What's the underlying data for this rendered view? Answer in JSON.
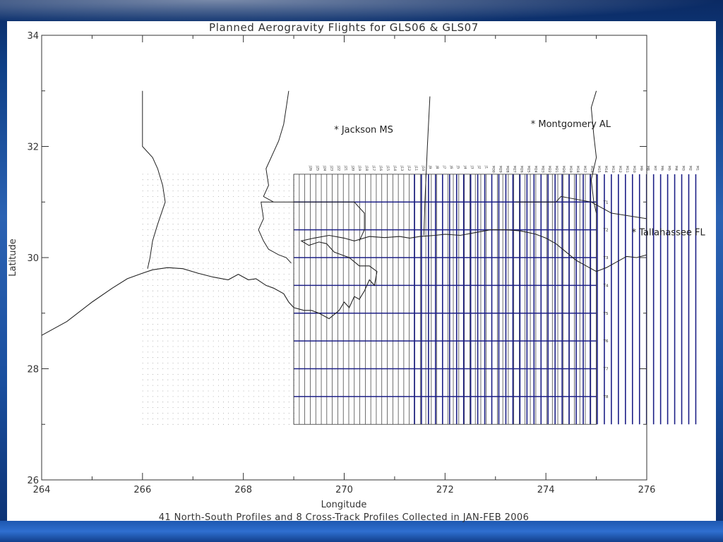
{
  "chart_data": {
    "type": "line",
    "title": "Planned Aerogravity Flights for GLS06 & GLS07",
    "subtitle": "41 North-South Profiles and 8 Cross-Track Profiles Collected in JAN-FEB 2006",
    "xlabel": "Longitude",
    "ylabel": "Latitude",
    "xlim": [
      264,
      276
    ],
    "ylim": [
      26,
      34
    ],
    "x_ticks": [
      "264",
      "266",
      "268",
      "270",
      "272",
      "274",
      "276"
    ],
    "y_ticks": [
      "26",
      "28",
      "30",
      "32",
      "34"
    ],
    "grid": false,
    "cities": [
      {
        "label": "Jackson MS",
        "lon": 269.8,
        "lat": 32.3
      },
      {
        "label": "Montgomery AL",
        "lon": 273.7,
        "lat": 32.4
      },
      {
        "label": "Tallahassee FL",
        "lon": 275.7,
        "lat": 30.45
      }
    ],
    "dotted_grid": {
      "lon_range": [
        266.0,
        269.0
      ],
      "lat_range": [
        27.0,
        31.5
      ],
      "lon_step": 0.1,
      "lat_step": 0.1
    },
    "planned_ns_lines": {
      "lon_start": 269.0,
      "lon_end": 275.0,
      "count": 56,
      "lat_range": [
        27.0,
        31.5
      ]
    },
    "ns_profiles": {
      "lon_start": 269.3,
      "lon_step": 0.1395,
      "lat_range": [
        27.0,
        31.5
      ],
      "labels": [
        "J26",
        "J25",
        "J24",
        "J23",
        "J22",
        "J21",
        "J20",
        "J19",
        "J18",
        "J17",
        "J16",
        "J15",
        "J14",
        "J13",
        "J12",
        "J11",
        "J10",
        "J9",
        "J8",
        "J7",
        "J6",
        "J5",
        "J4",
        "J3",
        "J2",
        "J1",
        "M30",
        "M29",
        "M28",
        "M27",
        "M26",
        "M25",
        "M24",
        "M23",
        "M22",
        "M21",
        "M20",
        "M19",
        "M18",
        "M17",
        "M16",
        "M15",
        "M14",
        "M13",
        "M12",
        "M11",
        "M10",
        "M9",
        "M8",
        "M7",
        "M6",
        "M5",
        "M4",
        "M3",
        "M2",
        "M1"
      ],
      "collected_from_index": 15
    },
    "cross_track_profiles": [
      {
        "label": "T1",
        "lat": 31.0
      },
      {
        "label": "T2",
        "lat": 30.5
      },
      {
        "label": "T3",
        "lat": 30.0
      },
      {
        "label": "T4",
        "lat": 29.5
      },
      {
        "label": "T5",
        "lat": 29.0
      },
      {
        "label": "T6",
        "lat": 28.5
      },
      {
        "label": "T7",
        "lat": 28.0
      },
      {
        "label": "T8",
        "lat": 27.5
      }
    ],
    "cross_track_lon_range": [
      269.0,
      275.0
    ],
    "colors": {
      "collected": "#1c1f86",
      "planned": "#333333",
      "coast": "#222222"
    },
    "coastline": [
      [
        264.0,
        28.6
      ],
      [
        264.5,
        28.85
      ],
      [
        265.0,
        29.2
      ],
      [
        265.4,
        29.45
      ],
      [
        265.7,
        29.62
      ],
      [
        266.0,
        29.72
      ],
      [
        266.2,
        29.78
      ],
      [
        266.5,
        29.82
      ],
      [
        266.8,
        29.8
      ],
      [
        267.1,
        29.72
      ],
      [
        267.4,
        29.65
      ],
      [
        267.7,
        29.6
      ],
      [
        267.9,
        29.7
      ],
      [
        268.1,
        29.6
      ],
      [
        268.25,
        29.62
      ],
      [
        268.45,
        29.5
      ],
      [
        268.6,
        29.45
      ],
      [
        268.8,
        29.35
      ],
      [
        268.9,
        29.2
      ],
      [
        269.0,
        29.1
      ],
      [
        269.2,
        29.05
      ],
      [
        269.35,
        29.05
      ],
      [
        269.5,
        29.0
      ],
      [
        269.7,
        28.9
      ],
      [
        269.9,
        29.05
      ],
      [
        270.0,
        29.2
      ],
      [
        270.1,
        29.1
      ],
      [
        270.2,
        29.3
      ],
      [
        270.3,
        29.25
      ],
      [
        270.4,
        29.4
      ],
      [
        270.5,
        29.6
      ],
      [
        270.6,
        29.5
      ],
      [
        270.65,
        29.75
      ],
      [
        270.5,
        29.85
      ],
      [
        270.3,
        29.85
      ],
      [
        270.1,
        30.0
      ],
      [
        269.95,
        30.05
      ],
      [
        269.8,
        30.1
      ],
      [
        269.65,
        30.25
      ],
      [
        269.5,
        30.28
      ],
      [
        269.3,
        30.22
      ],
      [
        269.15,
        30.3
      ],
      [
        269.4,
        30.35
      ],
      [
        269.7,
        30.4
      ],
      [
        270.0,
        30.35
      ],
      [
        270.2,
        30.3
      ],
      [
        270.5,
        30.38
      ],
      [
        270.8,
        30.36
      ],
      [
        271.1,
        30.38
      ],
      [
        271.3,
        30.35
      ],
      [
        271.5,
        30.38
      ],
      [
        271.8,
        30.4
      ],
      [
        272.0,
        30.42
      ],
      [
        272.3,
        30.4
      ],
      [
        272.6,
        30.45
      ],
      [
        272.9,
        30.5
      ],
      [
        273.2,
        30.5
      ],
      [
        273.5,
        30.48
      ],
      [
        273.8,
        30.42
      ],
      [
        274.0,
        30.35
      ],
      [
        274.2,
        30.25
      ],
      [
        274.4,
        30.1
      ],
      [
        274.6,
        29.95
      ],
      [
        274.8,
        29.85
      ],
      [
        275.0,
        29.75
      ],
      [
        275.2,
        29.82
      ],
      [
        275.4,
        29.92
      ],
      [
        275.6,
        30.02
      ],
      [
        275.8,
        30.0
      ],
      [
        276.0,
        30.05
      ]
    ],
    "state_borders": [
      [
        [
          266.0,
          33.0
        ],
        [
          266.0,
          32.0
        ],
        [
          266.2,
          31.8
        ],
        [
          266.3,
          31.6
        ],
        [
          266.4,
          31.3
        ],
        [
          266.45,
          31.0
        ],
        [
          266.3,
          30.6
        ],
        [
          266.2,
          30.3
        ],
        [
          266.15,
          30.0
        ],
        [
          266.1,
          29.8
        ]
      ],
      [
        [
          268.9,
          33.0
        ],
        [
          268.85,
          32.7
        ],
        [
          268.8,
          32.4
        ],
        [
          268.7,
          32.1
        ],
        [
          268.6,
          31.9
        ],
        [
          268.45,
          31.6
        ],
        [
          268.5,
          31.3
        ],
        [
          268.4,
          31.1
        ],
        [
          268.6,
          31.0
        ],
        [
          268.35,
          31.0
        ],
        [
          268.4,
          30.7
        ],
        [
          268.3,
          30.5
        ],
        [
          268.4,
          30.3
        ],
        [
          268.5,
          30.15
        ],
        [
          268.7,
          30.05
        ],
        [
          268.85,
          30.0
        ],
        [
          268.95,
          29.9
        ]
      ],
      [
        [
          268.6,
          31.0
        ],
        [
          269.0,
          31.0
        ],
        [
          270.2,
          31.0
        ],
        [
          270.4,
          30.8
        ],
        [
          270.4,
          30.5
        ],
        [
          270.3,
          30.3
        ]
      ],
      [
        [
          271.7,
          32.9
        ],
        [
          271.65,
          32.0
        ],
        [
          271.6,
          31.0
        ],
        [
          271.58,
          30.4
        ]
      ],
      [
        [
          273.4,
          31.0
        ],
        [
          274.2,
          31.0
        ],
        [
          274.3,
          31.1
        ],
        [
          274.9,
          31.0
        ],
        [
          275.3,
          30.8
        ],
        [
          276.0,
          30.7
        ]
      ],
      [
        [
          275.0,
          33.0
        ],
        [
          274.9,
          32.7
        ],
        [
          274.95,
          32.2
        ],
        [
          275.0,
          31.8
        ],
        [
          274.9,
          31.4
        ],
        [
          274.95,
          31.0
        ],
        [
          275.0,
          30.8
        ]
      ]
    ]
  }
}
